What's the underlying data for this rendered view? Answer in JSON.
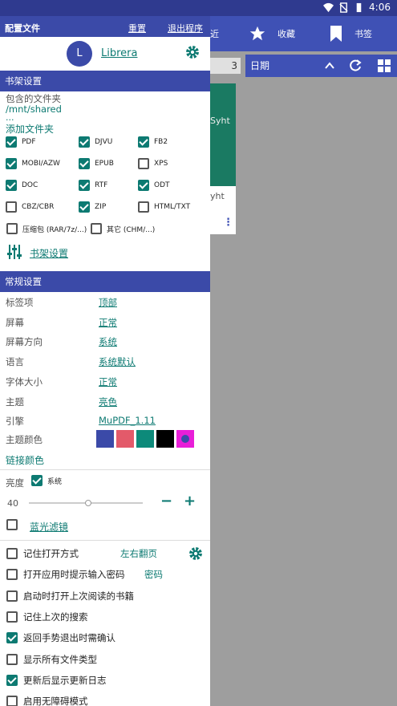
{
  "status_bar": {
    "time": "4:06"
  },
  "background": {
    "tabs": [
      {
        "label": "近",
        "icon": "clock-icon"
      },
      {
        "label": "收藏",
        "icon": "star-icon"
      },
      {
        "label": "书签",
        "icon": "bookmark-icon"
      }
    ],
    "count": "3",
    "sort_label": "日期",
    "card_title_fragment": "Syht",
    "card_subtitle_fragment": "yht"
  },
  "drawer": {
    "header": {
      "title": "配置文件",
      "reset": "重置",
      "exit": "退出程序"
    },
    "profile": {
      "avatar_letter": "L",
      "name": "Librera"
    },
    "library": {
      "section_title": "书架设置",
      "folders_label": "包含的文件夹",
      "folder_path": "/mnt/shared",
      "folder_ellipsis": "...",
      "add_folder": "添加文件夹",
      "file_types": [
        {
          "label": "PDF",
          "checked": true
        },
        {
          "label": "DJVU",
          "checked": true
        },
        {
          "label": "FB2",
          "checked": true
        },
        {
          "label": "MOBI/AZW",
          "checked": true
        },
        {
          "label": "EPUB",
          "checked": true
        },
        {
          "label": "XPS",
          "checked": false
        },
        {
          "label": "DOC",
          "checked": true
        },
        {
          "label": "RTF",
          "checked": true
        },
        {
          "label": "ODT",
          "checked": true
        },
        {
          "label": "CBZ/CBR",
          "checked": false
        },
        {
          "label": "ZIP",
          "checked": true
        },
        {
          "label": "HTML/TXT",
          "checked": false
        },
        {
          "label": "压缩包 (RAR/7z/...)",
          "checked": false
        },
        {
          "label": "其它 (CHM/...)",
          "checked": false
        }
      ],
      "settings_link": "书架设置"
    },
    "general": {
      "section_title": "常规设置",
      "rows": [
        {
          "key": "标签项",
          "value": "顶部"
        },
        {
          "key": "屏幕",
          "value": "正常"
        },
        {
          "key": "屏幕方向",
          "value": "系统"
        },
        {
          "key": "语言",
          "value": "系统默认"
        },
        {
          "key": "字体大小",
          "value": "正常"
        },
        {
          "key": "主题",
          "value": "亮色"
        },
        {
          "key": "引擎",
          "value": "MuPDF_1.11"
        }
      ],
      "theme_color_label": "主题颜色",
      "theme_colors": [
        "#3b4aa8",
        "#e35a6a",
        "#0d8a7a",
        "#000000",
        "#e81ed8"
      ],
      "link_color_label": "链接颜色",
      "accent_color": "#0d7a72"
    },
    "brightness": {
      "label": "亮度",
      "system_label": "系统",
      "system_checked": true,
      "value": "40",
      "slider_fraction": 0.52,
      "blue_filter_label": "蓝光滤镜",
      "blue_filter_checked": false
    },
    "options": [
      {
        "label": "记住打开方式",
        "checked": false,
        "extra": "左右翻页"
      },
      {
        "label": "打开应用时提示输入密码",
        "checked": false,
        "extra": "密码"
      },
      {
        "label": "启动时打开上次阅读的书籍",
        "checked": false
      },
      {
        "label": "记住上次的搜索",
        "checked": false
      },
      {
        "label": "返回手势退出时需确认",
        "checked": true
      },
      {
        "label": "显示所有文件类型",
        "checked": false
      },
      {
        "label": "更新后显示更新日志",
        "checked": true
      },
      {
        "label": "启用无障碍模式",
        "checked": false
      }
    ]
  }
}
